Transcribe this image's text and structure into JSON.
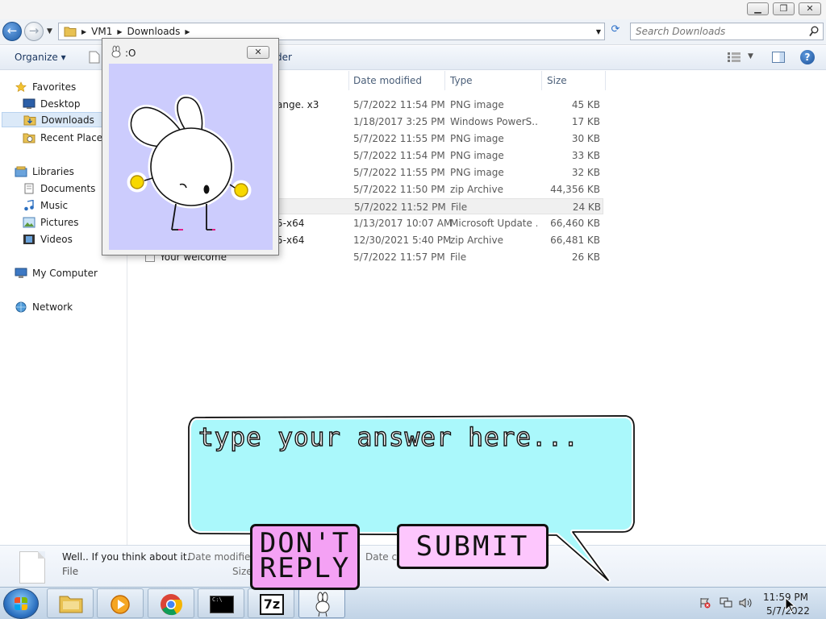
{
  "explorer": {
    "breadcrumb": [
      "VM1",
      "Downloads"
    ],
    "search_placeholder": "Search Downloads",
    "toolbar": {
      "organize": "Organize",
      "new_folder_partial": "der"
    },
    "nav": {
      "favorites": "Favorites",
      "desktop": "Desktop",
      "downloads": "Downloads",
      "recent_places": "Recent Places",
      "libraries": "Libraries",
      "documents": "Documents",
      "music": "Music",
      "pictures": "Pictures",
      "videos": "Videos",
      "my_computer": "My Computer",
      "network": "Network"
    },
    "columns": {
      "date": "Date modified",
      "type": "Type",
      "size": "Size"
    },
    "files": [
      {
        "name": "ange. x3",
        "date": "5/7/2022 11:54 PM",
        "type": "PNG image",
        "size": "45 KB"
      },
      {
        "name": "",
        "date": "1/18/2017 3:25 PM",
        "type": "Windows PowerS...",
        "size": "17 KB"
      },
      {
        "name": "",
        "date": "5/7/2022 11:55 PM",
        "type": "PNG image",
        "size": "30 KB"
      },
      {
        "name": "",
        "date": "5/7/2022 11:54 PM",
        "type": "PNG image",
        "size": "33 KB"
      },
      {
        "name": "",
        "date": "5/7/2022 11:55 PM",
        "type": "PNG image",
        "size": "32 KB"
      },
      {
        "name": "",
        "date": "5/7/2022 11:50 PM",
        "type": "zip Archive",
        "size": "44,356 KB"
      },
      {
        "name": "",
        "date": "5/7/2022 11:52 PM",
        "type": "File",
        "size": "24 KB"
      },
      {
        "name": "5-x64",
        "date": "1/13/2017 10:07 AM",
        "type": "Microsoft Update ...",
        "size": "66,460 KB"
      },
      {
        "name": "5-x64",
        "date": "12/30/2021 5:40 PM",
        "type": "zip Archive",
        "size": "66,481 KB"
      },
      {
        "name": "Your welcome",
        "date": "5/7/2022 11:57 PM",
        "type": "File",
        "size": "26 KB"
      }
    ],
    "details": {
      "name": "Well.. If you think about it.",
      "kind": "File",
      "date_modified_label": "Date modified",
      "size_label": "Size",
      "date_created_label": "Date cr"
    }
  },
  "popup": {
    "title": ":O",
    "close": "✕"
  },
  "bubble": {
    "placeholder": "type your answer here...",
    "dont_reply_line1": "DON'T",
    "dont_reply_line2": "REPLY",
    "submit": "SUBMIT"
  },
  "taskbar": {
    "clock_time": "11:59 PM",
    "clock_date": "5/7/2022",
    "cmd_label": "C:\\",
    "sevenzip_label": "7z"
  },
  "colors": {
    "bubble_fill": "#aaf8fb",
    "popup_bg": "#ccccfd",
    "dont_reply_fill": "#f4a1f4",
    "submit_fill": "#fdc6fd"
  }
}
